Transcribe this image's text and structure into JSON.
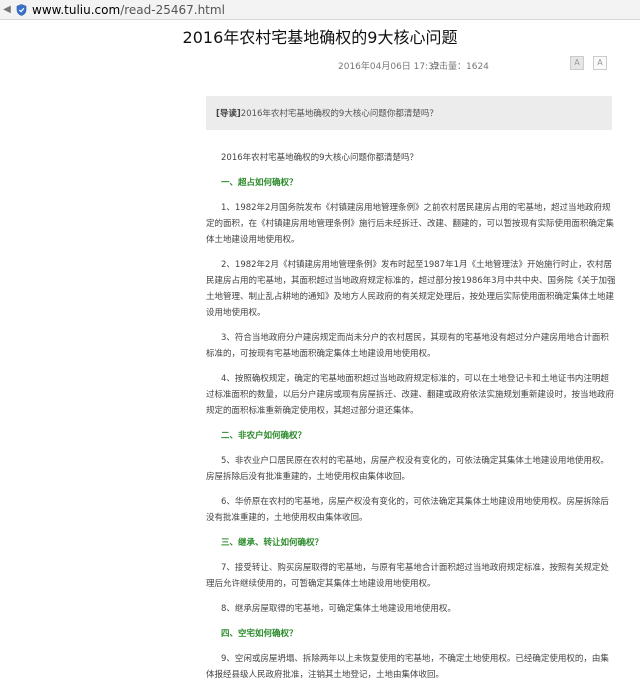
{
  "browser": {
    "url_host": "www.tuliu.com",
    "url_path": "/read-25467.html"
  },
  "article": {
    "title": "2016年农村宅基地确权的9大核心问题",
    "date": "2016年04月06日 17:32",
    "views": "点击量：1624",
    "lead_prefix": "[导读]",
    "lead_text": "2016年农村宅基地确权的9大核心问题你都清楚吗？",
    "font_large": "A",
    "font_small": "A",
    "intro": "2016年农村宅基地确权的9大核心问题你都清楚吗？",
    "sections": [
      {
        "heading": "一、超占如何确权？",
        "paragraphs": [
          "1、1982年2月国务院发布《村镇建房用地管理条例》之前农村居民建房占用的宅基地，超过当地政府规定的面积，在《村镇建房用地管理条例》施行后未经拆迁、改建、翻建的，可以暂按现有实际使用面积确定集体土地建设用地使用权。",
          "2、1982年2月《村镇建房用地管理条例》发布时起至1987年1月《土地管理法》开始施行时止，农村居民建房占用的宅基地，其面积超过当地政府规定标准的，超过部分按1986年3月中共中央、国务院《关于加强土地管理、制止乱占耕地的通知》及地方人民政府的有关规定处理后，按处理后实际使用面积确定集体土地建设用地使用权。",
          "3、符合当地政府分户建房规定而尚未分户的农村居民，其现有的宅基地没有超过分户建房用地合计面积标准的，可按现有宅基地面积确定集体土地建设用地使用权。",
          "4、按照确权规定，确定的宅基地面积超过当地政府规定标准的，可以在土地登记卡和土地证书内注明超过标准面积的数量，以后分户建房或现有房屋拆迁、改建、翻建或政府依法实施规划重新建设时，按当地政府规定的面积标准重新确定使用权，其超过部分退还集体。"
        ]
      },
      {
        "heading": "二、非农户如何确权？",
        "paragraphs": [
          "5、非农业户口居民原在农村的宅基地，房屋产权没有变化的，可依法确定其集体土地建设用地使用权。房屋拆除后没有批准重建的，土地使用权由集体收回。",
          "6、华侨原在农村的宅基地，房屋产权没有变化的，可依法确定其集体土地建设用地使用权。房屋拆除后没有批准重建的，土地使用权由集体收回。"
        ]
      },
      {
        "heading": "三、继承、转让如何确权？",
        "paragraphs": [
          "7、接受转让、购买房屋取得的宅基地，与原有宅基地合计面积超过当地政府规定标准，按照有关规定处理后允许继续使用的，可暂确定其集体土地建设用地使用权。",
          "8、继承房屋取得的宅基地，可确定集体土地建设用地使用权。"
        ]
      },
      {
        "heading": "四、空宅如何确权？",
        "paragraphs": [
          "9、空闲或房屋坍塌、拆除两年以上未恢复使用的宅基地，不确定土地使用权。已经确定使用权的，由集体报经县级人民政府批准，注销其土地登记，土地由集体收回。"
        ]
      }
    ]
  }
}
